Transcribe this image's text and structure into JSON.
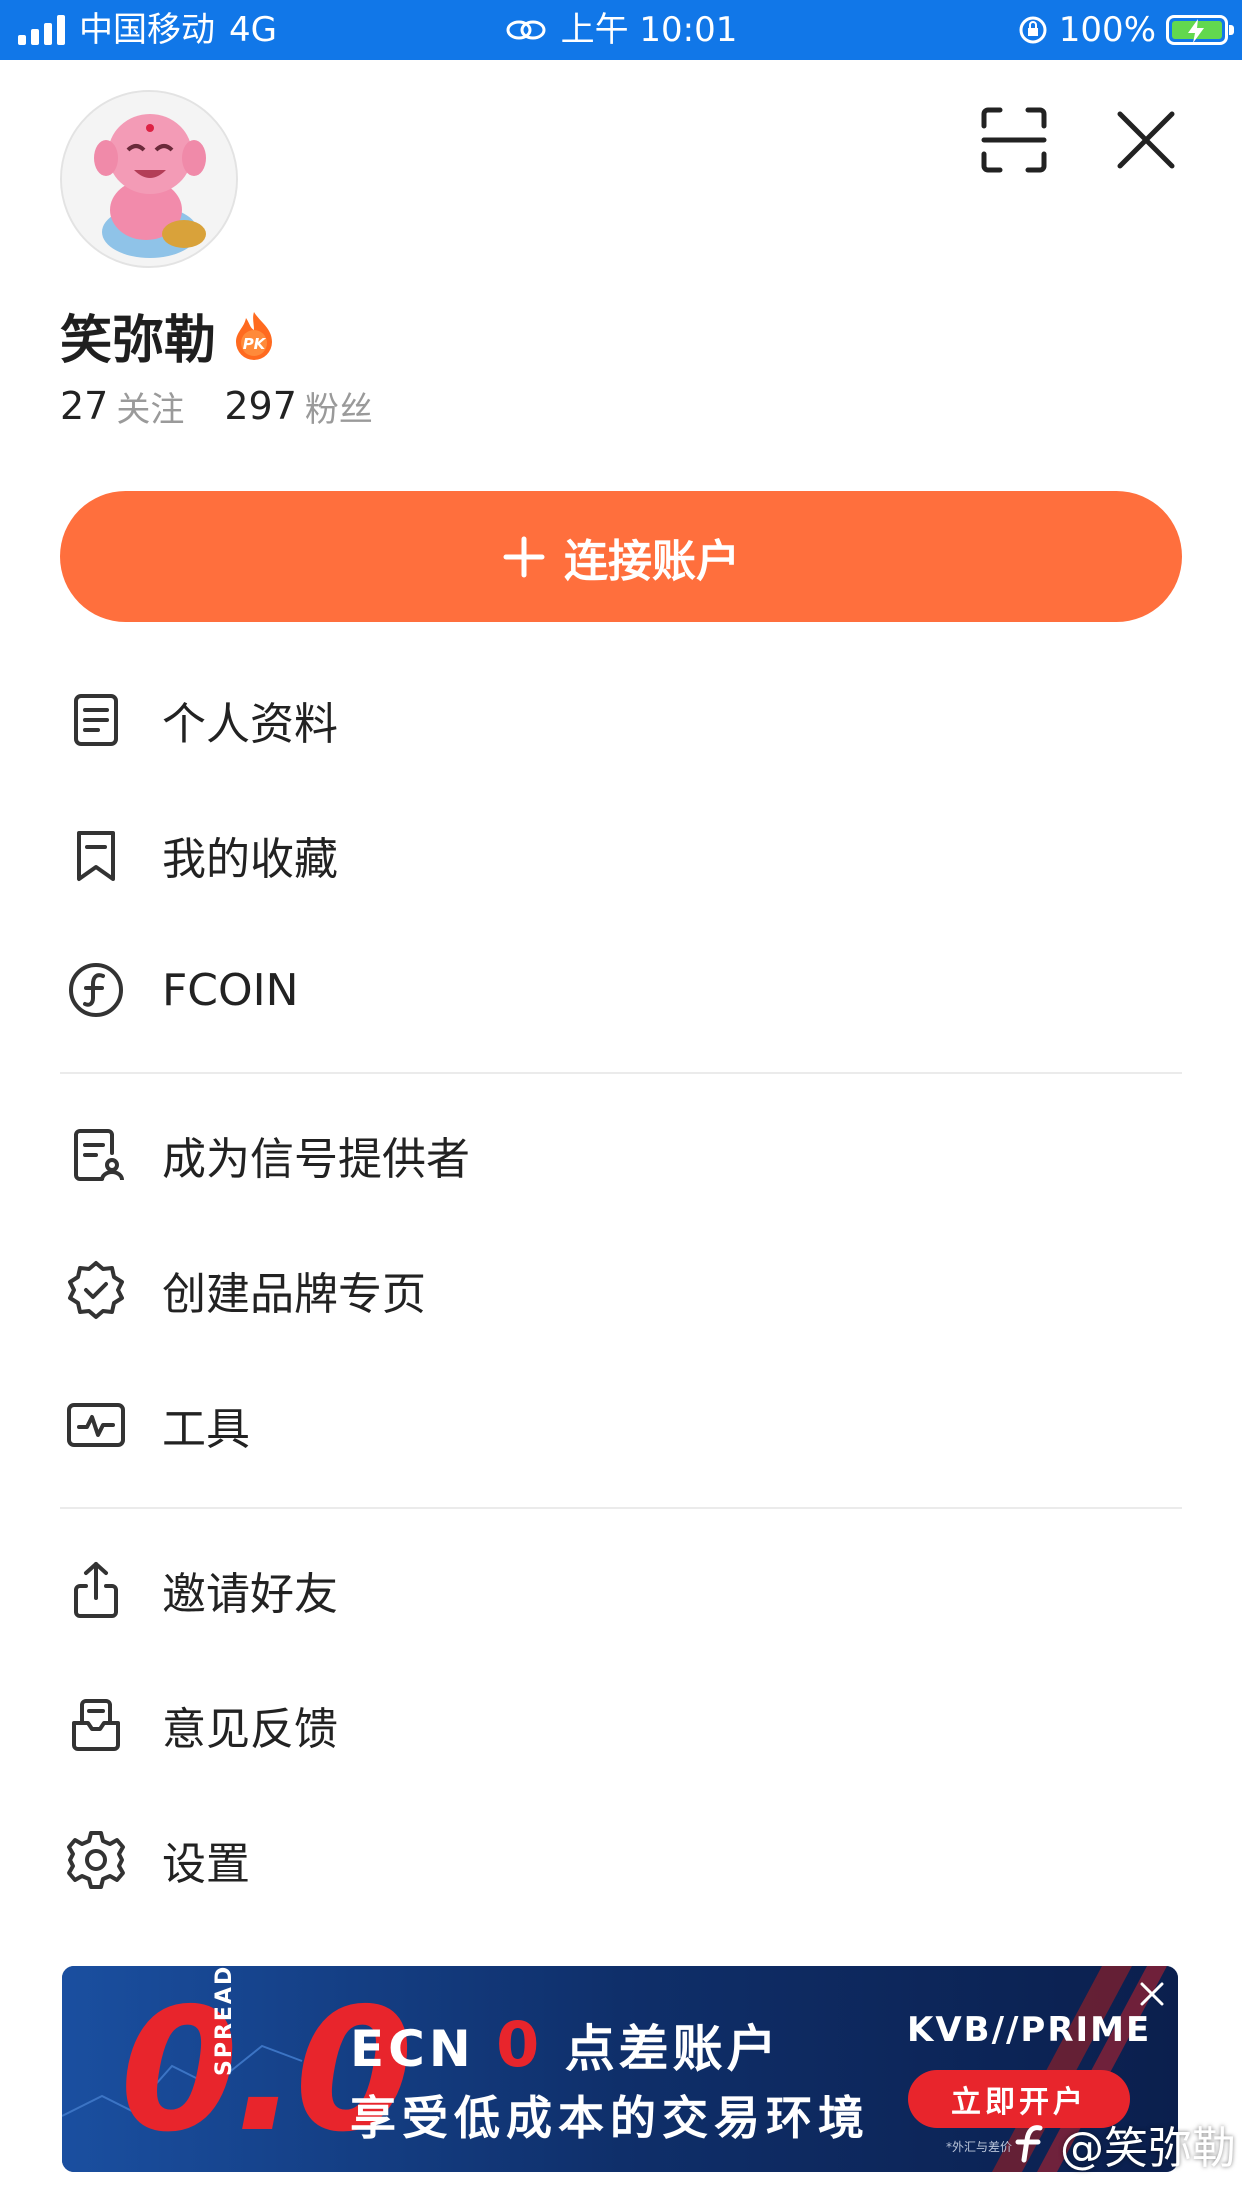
{
  "status_bar": {
    "carrier": "中国移动",
    "network": "4G",
    "time": "上午 10:01",
    "battery": "100%",
    "icons": [
      "signal-icon",
      "link-icon",
      "orientation-lock-icon",
      "battery-charging-icon"
    ]
  },
  "profile": {
    "username": "笑弥勒",
    "badge_text": "PK",
    "following_count": "27",
    "following_label": "关注",
    "followers_count": "297",
    "followers_label": "粉丝"
  },
  "header_icons": [
    "scan-icon",
    "close-icon"
  ],
  "connect_button": {
    "label": "连接账户"
  },
  "menu": {
    "group1": [
      {
        "label": "个人资料",
        "icon": "profile-doc-icon"
      },
      {
        "label": "我的收藏",
        "icon": "bookmark-icon"
      },
      {
        "label": "FCOIN",
        "icon": "fcoin-icon"
      }
    ],
    "group2": [
      {
        "label": "成为信号提供者",
        "icon": "signal-provider-icon"
      },
      {
        "label": "创建品牌专页",
        "icon": "verified-badge-icon"
      },
      {
        "label": "工具",
        "icon": "tools-chart-icon"
      }
    ],
    "group3": [
      {
        "label": "邀请好友",
        "icon": "share-icon"
      },
      {
        "label": "意见反馈",
        "icon": "feedback-icon"
      },
      {
        "label": "设置",
        "icon": "settings-gear-icon"
      }
    ]
  },
  "banner": {
    "big_number": "0.0",
    "spreads_text": "SPREADS",
    "title_prefix": "ECN",
    "title_zero": "0",
    "title_suffix": "点差账户",
    "subtitle": "享受低成本的交易环境",
    "brand": "KVB//PRIME",
    "cta": "立即开户",
    "fine_print": "*外汇与差价"
  },
  "watermark": "@笑弥勒",
  "colors": {
    "status_bar": "#1177e8",
    "accent": "#ff6f3d",
    "banner_bg": "#10306a",
    "banner_red": "#e8252c"
  }
}
